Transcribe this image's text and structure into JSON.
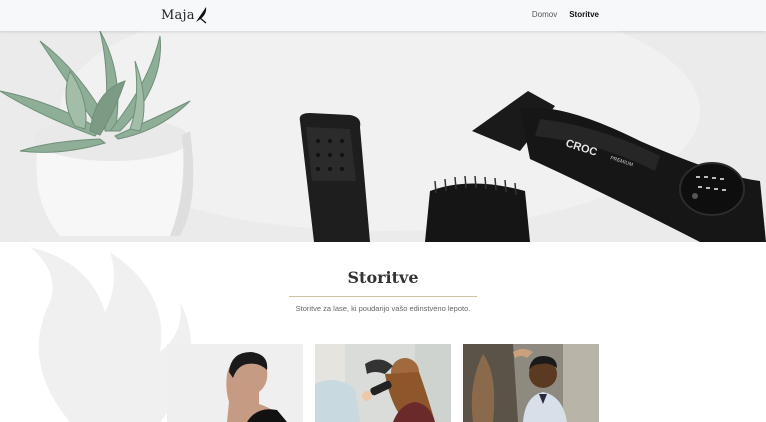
{
  "header": {
    "logo_text": "Maja",
    "nav": [
      {
        "label": "Domov",
        "active": false
      },
      {
        "label": "Storitve",
        "active": true
      }
    ]
  },
  "hero": {
    "image_alt": "Hair dryer, brush, straightener and succulent plant",
    "brand_text": "CROC",
    "brand_sub": "PREMIUM"
  },
  "section": {
    "title": "Storitve",
    "subtitle": "Storitve za lase, ki poudarijo vašo edinstveno lepoto."
  },
  "colors": {
    "accent_rule": "#cfc2a4",
    "header_bg": "#f7f8f9",
    "hero_bg": "#ececec"
  }
}
